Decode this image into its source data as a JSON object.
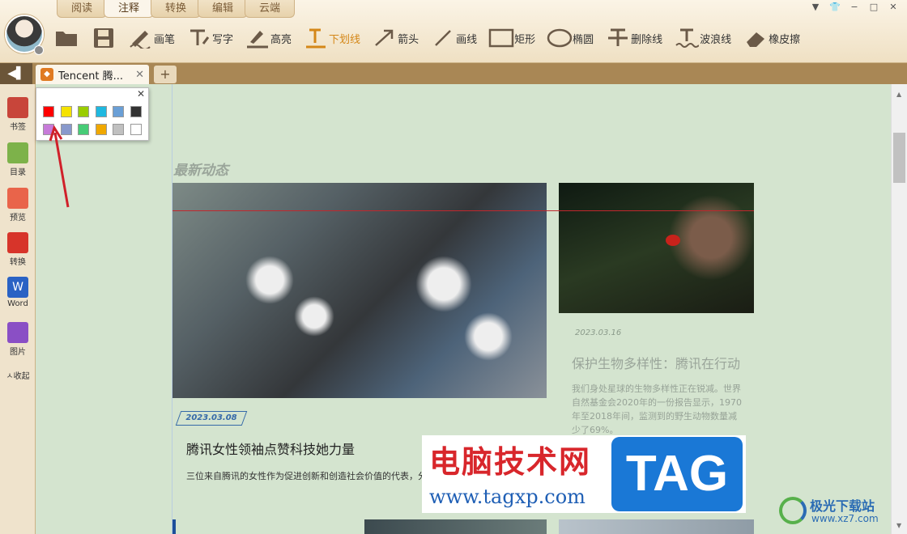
{
  "menu_tabs": [
    "阅读",
    "注释",
    "转换",
    "编辑",
    "云端"
  ],
  "active_tab_index": 1,
  "window_controls": [
    "▼",
    "👕",
    "−",
    "□",
    "✕"
  ],
  "tools": [
    {
      "name": "open-folder",
      "label": ""
    },
    {
      "name": "save",
      "label": ""
    },
    {
      "name": "pen",
      "label": "画笔"
    },
    {
      "name": "write",
      "label": "写字"
    },
    {
      "name": "highlight",
      "label": "高亮"
    },
    {
      "name": "underline",
      "label": "下划线"
    },
    {
      "name": "arrow",
      "label": "箭头"
    },
    {
      "name": "line",
      "label": "画线"
    },
    {
      "name": "rectangle",
      "label": "矩形"
    },
    {
      "name": "ellipse",
      "label": "椭圆"
    },
    {
      "name": "strikethrough",
      "label": "删除线"
    },
    {
      "name": "wavy-line",
      "label": "波浪线"
    },
    {
      "name": "eraser",
      "label": "橡皮擦"
    }
  ],
  "selected_tool": "underline",
  "doc_tab": {
    "title": "Tencent 腾...",
    "close": "✕",
    "add": "+"
  },
  "sidebar": [
    {
      "label": "书签",
      "color": "#c8453a"
    },
    {
      "label": "目录",
      "color": "#7db24a"
    },
    {
      "label": "预览",
      "color": "#e9644a"
    },
    {
      "label": "转换",
      "color": "#d7342a"
    },
    {
      "label": "Word",
      "color": "#2a62c4"
    },
    {
      "label": "图片",
      "color": "#8a4fc5"
    }
  ],
  "sidebar_collapse": "ㅅ收起",
  "palette": {
    "close": "✕",
    "colors": [
      "#ff0000",
      "#f5e200",
      "#9acd00",
      "#1fb8e0",
      "#6a9fd6",
      "#333333",
      "#c77bd9",
      "#8899cc",
      "#47cc77",
      "#f0a800",
      "#c0c0c0",
      "#ffffff"
    ]
  },
  "content": {
    "section_title": "最新动态",
    "article1": {
      "date": "2023.03.08",
      "title": "腾讯女性领袖点赞科技她力量",
      "body": "三位来自腾讯的女性作为促进创新和创造社会价值的代表，分享了各自的故事。"
    },
    "article2": {
      "date": "2023.03.16",
      "title": "保护生物多样性：腾讯在行动",
      "body": "我们身处星球的生物多样性正在锐减。世界自然基金会2020年的一份报告显示，1970年至2018年间，监测到的野生动物数量减少了69%。"
    }
  },
  "watermark": {
    "cn": "电脑技术网",
    "url": "www.tagxp.com",
    "tag": "TAG",
    "site2_cn": "极光下载站",
    "site2_url": "www.xz7.com"
  },
  "colors": {
    "accent": "#d48718",
    "page_bg": "#d4e4cf",
    "frame": "#c9a777"
  }
}
